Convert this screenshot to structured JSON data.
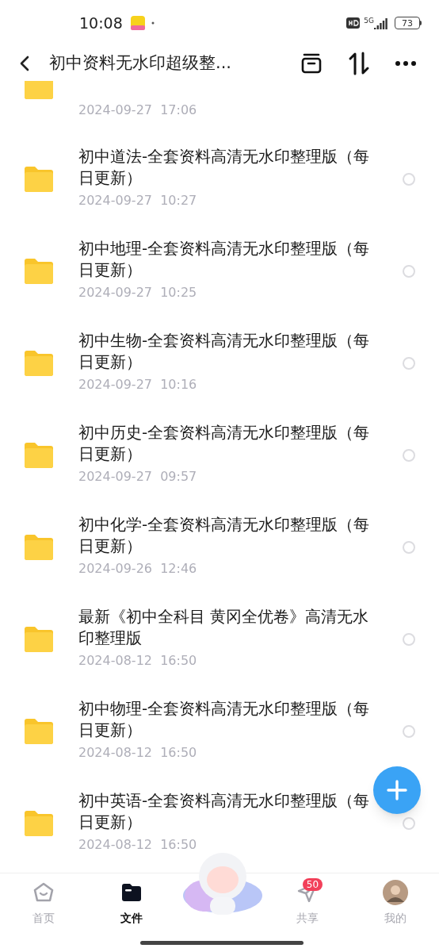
{
  "status_bar": {
    "time": "10:08",
    "network": "5G",
    "battery": "73"
  },
  "header": {
    "title": "初中资料无水印超级整..."
  },
  "partial_item": {
    "date": "2024-09-27  17:06"
  },
  "files": [
    {
      "name": "初中道法-全套资料高清无水印整理版（每日更新）",
      "date": "2024-09-27  10:27",
      "selected": false
    },
    {
      "name": "初中地理-全套资料高清无水印整理版（每日更新）",
      "date": "2024-09-27  10:25",
      "selected": false
    },
    {
      "name": "初中生物-全套资料高清无水印整理版（每日更新）",
      "date": "2024-09-27  10:16",
      "selected": false
    },
    {
      "name": "初中历史-全套资料高清无水印整理版（每日更新）",
      "date": "2024-09-27  09:57",
      "selected": false
    },
    {
      "name": "初中化学-全套资料高清无水印整理版（每日更新）",
      "date": "2024-09-26  12:46",
      "selected": false
    },
    {
      "name": "最新《初中全科目 黄冈全优卷》高清无水印整理版",
      "date": "2024-08-12  16:50",
      "selected": false
    },
    {
      "name": "初中物理-全套资料高清无水印整理版（每日更新）",
      "date": "2024-08-12  16:50",
      "selected": false
    },
    {
      "name": "初中英语-全套资料高清无水印整理版（每日更新）",
      "date": "2024-08-12  16:50",
      "selected": false
    }
  ],
  "nav": [
    {
      "kind": "home",
      "label": "首页",
      "selected": false
    },
    {
      "kind": "files",
      "label": "文件",
      "selected": true
    },
    {
      "kind": "mascot"
    },
    {
      "kind": "share",
      "label": "共享",
      "selected": false,
      "badge": "50"
    },
    {
      "kind": "profile",
      "label": "我的",
      "selected": false
    }
  ]
}
